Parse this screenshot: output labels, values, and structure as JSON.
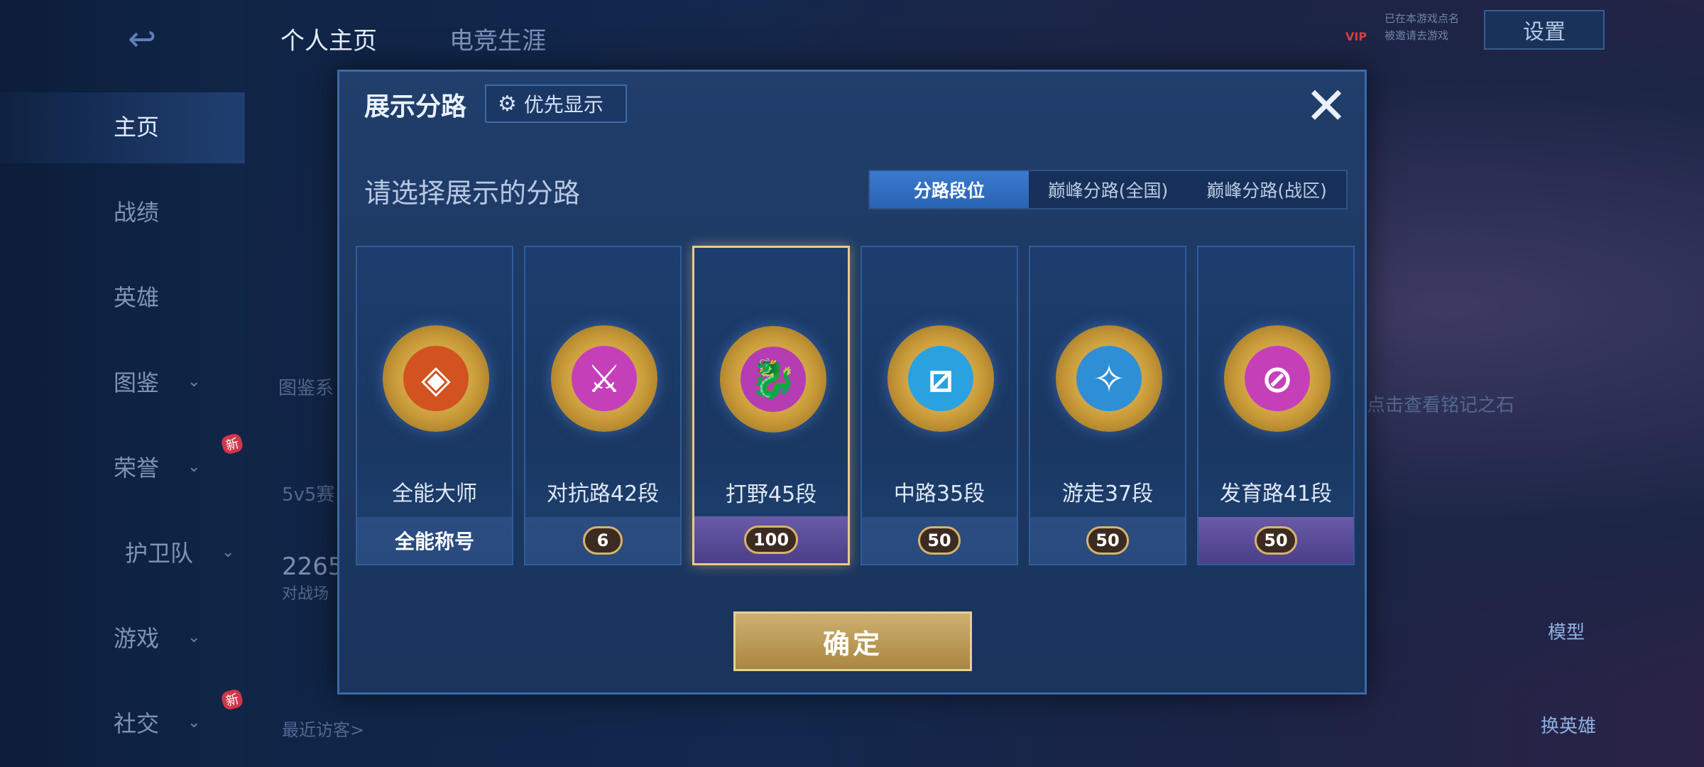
{
  "sidebar": {
    "items": [
      {
        "label": "主页",
        "active": true,
        "has_chevron": false,
        "is_new": false
      },
      {
        "label": "战绩",
        "active": false,
        "has_chevron": false,
        "is_new": false
      },
      {
        "label": "英雄",
        "active": false,
        "has_chevron": false,
        "is_new": false
      },
      {
        "label": "图鉴",
        "active": false,
        "has_chevron": true,
        "is_new": false
      },
      {
        "label": "荣誉",
        "active": false,
        "has_chevron": true,
        "is_new": true
      },
      {
        "label": "护卫队",
        "active": false,
        "has_chevron": true,
        "is_new": false
      },
      {
        "label": "游戏",
        "active": false,
        "has_chevron": true,
        "is_new": false
      },
      {
        "label": "社交",
        "active": false,
        "has_chevron": true,
        "is_new": true
      }
    ],
    "new_badge": "新"
  },
  "top_tabs": [
    "个人主页",
    "电竞生涯"
  ],
  "header": {
    "settings_label": "设置",
    "vip_label": "VIP",
    "game_record_line1": "已在本游戏点名",
    "game_record_line2": "被邀请去游戏"
  },
  "background": {
    "gallery_text": "图鉴系",
    "mode_text": "5v5赛",
    "stat_number": "2265",
    "stat_label": "对战场",
    "recent_visitors": "最近访客>",
    "inscription_hint": "点击查看铭记之石",
    "model_label": "模型",
    "change_hero_label": "换英雄"
  },
  "dialog": {
    "title": "展示分路",
    "priority_label": "优先显示",
    "subtitle": "请选择展示的分路",
    "tabs": [
      {
        "label": "分路段位",
        "active": true
      },
      {
        "label": "巅峰分路(全国)",
        "active": false
      },
      {
        "label": "巅峰分路(战区)",
        "active": false
      }
    ],
    "cards": [
      {
        "name": "全能大师",
        "footer_text": "全能称号",
        "footer_type": "title",
        "selected": false,
        "emblem_color": "#d2531f",
        "emblem_icon": "all-round-icon",
        "emblem_glyph": "◈"
      },
      {
        "name": "对抗路42段",
        "footer_text": "6",
        "footer_type": "rank",
        "selected": false,
        "emblem_color": "#c53fb9",
        "emblem_icon": "clash-lane-icon",
        "emblem_glyph": "⚔"
      },
      {
        "name": "打野45段",
        "footer_text": "100",
        "footer_type": "rank-purple",
        "selected": true,
        "emblem_color": "#b63cb3",
        "emblem_icon": "jungle-icon",
        "emblem_glyph": "🐉"
      },
      {
        "name": "中路35段",
        "footer_text": "50",
        "footer_type": "rank",
        "selected": false,
        "emblem_color": "#2ba2e0",
        "emblem_icon": "mid-lane-icon",
        "emblem_glyph": "⧄"
      },
      {
        "name": "游走37段",
        "footer_text": "50",
        "footer_type": "rank",
        "selected": false,
        "emblem_color": "#2f8fd6",
        "emblem_icon": "roam-icon",
        "emblem_glyph": "✧"
      },
      {
        "name": "发育路41段",
        "footer_text": "50",
        "footer_type": "rank-purple",
        "selected": false,
        "emblem_color": "#c53fb9",
        "emblem_icon": "farm-lane-icon",
        "emblem_glyph": "⊘"
      }
    ],
    "confirm_label": "确定"
  }
}
